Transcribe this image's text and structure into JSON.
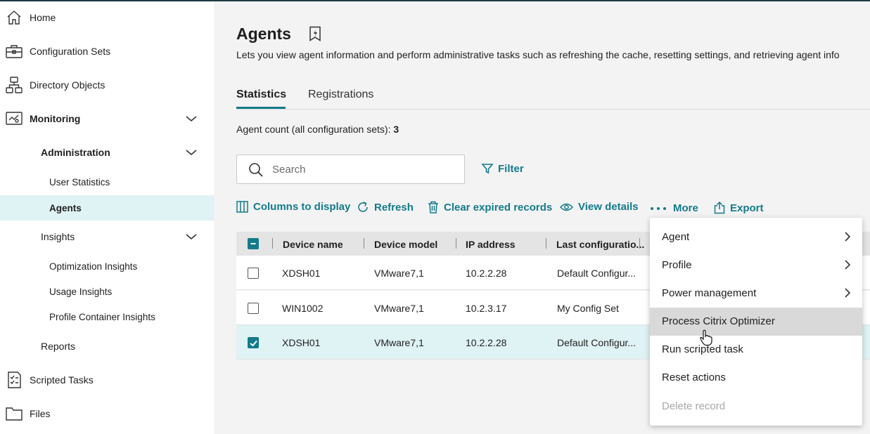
{
  "sidebar": {
    "home": "Home",
    "configuration_sets": "Configuration Sets",
    "directory_objects": "Directory Objects",
    "monitoring": "Monitoring",
    "administration": "Administration",
    "user_statistics": "User Statistics",
    "agents": "Agents",
    "insights": "Insights",
    "optimization_insights": "Optimization Insights",
    "usage_insights": "Usage Insights",
    "profile_container_insights": "Profile Container Insights",
    "reports": "Reports",
    "scripted_tasks": "Scripted Tasks",
    "files": "Files"
  },
  "page": {
    "title": "Agents",
    "description": "Lets you view agent information and perform administrative tasks such as refreshing the cache, resetting settings, and retrieving agent info",
    "tabs": [
      "Statistics",
      "Registrations"
    ],
    "agent_count_label": "Agent count (all configuration sets):",
    "agent_count": "3"
  },
  "search": {
    "placeholder": "Search"
  },
  "filter_label": "Filter",
  "toolbar": {
    "columns": "Columns to display",
    "refresh": "Refresh",
    "clear": "Clear expired records",
    "view_details": "View details",
    "more": "More",
    "export": "Export"
  },
  "table": {
    "headers": [
      "Device name",
      "Device model",
      "IP address",
      "Last configuratio..."
    ],
    "rows": [
      {
        "device": "XDSH01",
        "model": "VMware7,1",
        "ip": "10.2.2.28",
        "config": "Default Configur...",
        "checked": false
      },
      {
        "device": "WIN1002",
        "model": "VMware7,1",
        "ip": "10.2.3.17",
        "config": "My Config Set",
        "checked": false
      },
      {
        "device": "XDSH01",
        "model": "VMware7,1",
        "ip": "10.2.2.28",
        "config": "Default Configur...",
        "checked": true
      }
    ]
  },
  "menu": {
    "items": [
      {
        "label": "Agent",
        "submenu": true
      },
      {
        "label": "Profile",
        "submenu": true
      },
      {
        "label": "Power management",
        "submenu": true
      },
      {
        "label": "Process Citrix Optimizer",
        "submenu": false
      },
      {
        "label": "Run scripted task",
        "submenu": false
      },
      {
        "label": "Reset actions",
        "submenu": false
      },
      {
        "label": "Delete record",
        "submenu": false,
        "disabled": true
      }
    ]
  },
  "colors": {
    "accent": "#147b8a",
    "selected_row": "#dff2f4",
    "menu_hover": "#d9d9d9"
  }
}
